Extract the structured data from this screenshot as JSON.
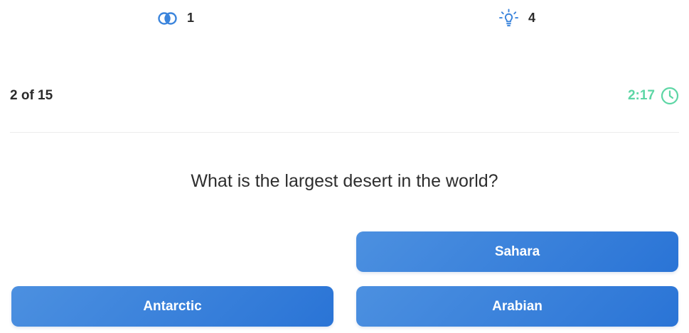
{
  "lifelines": {
    "fifty_fifty": {
      "icon": "fifty-fifty-icon",
      "count": "1"
    },
    "hint": {
      "icon": "lightbulb-icon",
      "count": "4"
    }
  },
  "status": {
    "progress": "2 of 15",
    "timer": "2:17",
    "timer_icon": "clock-icon"
  },
  "question": {
    "text": "What is the largest desert in the world?"
  },
  "answers": [
    {
      "label": "Sahara"
    },
    {
      "label": "Antarctic"
    },
    {
      "label": "Arabian"
    }
  ],
  "colors": {
    "accent_blue": "#3a84dc",
    "timer_green": "#5dd6a5",
    "text": "#2b2b2b"
  }
}
